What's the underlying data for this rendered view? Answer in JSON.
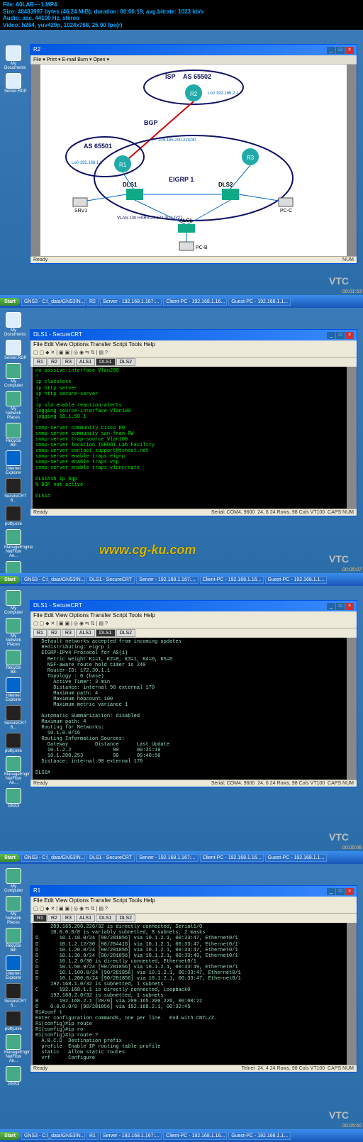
{
  "meta": {
    "file": "File: 60LAB~~1.MP4",
    "size": "Size: 48483997 bytes (46.24 MiB), duration: 00:06:19, avg.bitrate: 1023 kb/s",
    "audio": "Audio: aac, 44100 Hz, stereo",
    "video": "Video: h264, yuv420p, 1024x768, 25.00 fps(r)"
  },
  "watermark": "www.cg-ku.com",
  "vtc": "VTC",
  "desktop": {
    "icons_row1": [
      "My Documents",
      "Server.RDP"
    ],
    "icons_col": [
      "My Computer",
      "My Network Places",
      "Recycle Bin",
      "Internet Explorer",
      "SecureCRT 6...",
      "putty.exe",
      "ManageEngine NetFlow An...",
      "GNS3"
    ]
  },
  "taskbar": {
    "start": "Start",
    "items": [
      "GNS3 - C:\\_data\\GNS3\\N...",
      "R2",
      "Server - 192.168.1.167:...",
      "Client-PC - 192.168.1.16...",
      "Guest-PC - 192.168.1.1..."
    ],
    "items2": [
      "GNS3 - C:\\_data\\GNS3\\N...",
      "DLS1 - SecureCRT",
      "Server - 192.168.1.167:...",
      "Client-PC - 192.168.1.16...",
      "Guest-PC - 192.168.1.1..."
    ],
    "items3": [
      "GNS3 - C:\\_data\\GNS3\\N...",
      "R1",
      "Server - 192.168.1.167:...",
      "Client-PC - 192.168.1.16...",
      "Guest-PC - 192.168.1.1..."
    ]
  },
  "ts": [
    "00:01:53",
    "00:05:07",
    "00:05:08",
    "00:05:50"
  ],
  "panel1": {
    "window_title": "R2",
    "toolbar_items": "File ▾  Print ▾  E-mail  Burn ▾  Open ▾",
    "labels": {
      "isp": "ISP",
      "as2": "AS 65502",
      "r2": "R2",
      "r2ip": "Lo0\n192.168.2.1",
      "bgp": "BGP",
      "link": "209.165.200.224/30",
      "as1": "AS 65501",
      "r1ip": "Lo0\n192.168.1.1",
      "r1": "R1",
      "r3": "R3",
      "dls1": "DLS1",
      "dls2": "DLS2",
      "eigrp": "EIGRP 1",
      "srv1": "SRV1",
      "pcc": "PC-C",
      "als1": "ALS1",
      "pcb": "PC-B",
      "vlan": "VLAN 130 HSRVCS\n172.30.1.0/27"
    },
    "status_left": "Ready",
    "status_right": "NUM"
  },
  "panel2": {
    "window_title": "DLS1 - SecureCRT",
    "menu": "File  Edit  View  Options  Transfer  Script  Tools  Help",
    "tabs": [
      "R1",
      "R2",
      "R3",
      "ALS1",
      "DLS1",
      "DLS2"
    ],
    "active_tab": "DLS1",
    "lines": [
      "no passive-interface Vlan200",
      "!",
      "ip classless",
      "ip http server",
      "ip http secure-server",
      "!",
      "ip sla enable reaction-alerts",
      "logging source-interface Vlan100",
      "logging 10.1.50.1",
      "!",
      "snmp-server community cisco RO",
      "snmp-server community san-fran RW",
      "snmp-server trap-source Vlan100",
      "snmp-server location TSHOOT Lab Facility",
      "snmp-server contact support@tshoot.net",
      "snmp-server enable traps eigrp",
      "snmp-server enable traps vtp",
      "snmp-server enable traps vlancreate",
      "",
      "DLS1#sh ip bgp",
      "% BGP not active",
      "",
      "DLS1#"
    ],
    "status_left": "Ready",
    "status_mid": "Serial: COM4, 9600",
    "status_rows": "24, 6    24 Rows, 98 Cols  VT100",
    "status_caps": "CAPS NUM"
  },
  "panel3": {
    "window_title": "DLS1 - SecureCRT",
    "lines": [
      "  Default networks accepted from incoming updates",
      "  Redistributing: eigrp 1",
      "  EIGRP-IPv4 Protocol for AS(1)",
      "    Metric weight K1=1, K2=0, K3=1, K4=0, K5=0",
      "    NSF-aware route hold timer is 240",
      "    Router-ID: 172.30.1.1",
      "    Topology : 0 (base)",
      "      Active Timer: 3 min",
      "      Distance: internal 90 external 170",
      "      Maximum path: 4",
      "      Maximum hopcount 100",
      "      Maximum metric variance 1",
      "",
      "  Automatic Summarization: disabled",
      "  Maximum path: 4",
      "  Routing for Networks:",
      "    10.1.0.0/16",
      "  Routing Information Sources:",
      "    Gateway         Distance      Last Update",
      "    10.1.2.2              90      00:31:19",
      "    10.1.200.253          90      00:40:56",
      "  Distance: internal 90 external 170",
      "",
      "DLS1#"
    ]
  },
  "panel4": {
    "window_title": "R1",
    "active_tab": "R1",
    "lines": [
      "     209.165.200.226/32 is directly connected, Serial1/0",
      "     10.0.0.0/8 is variably subnetted, 8 subnets, 2 masks",
      "D       10.1.10.0/24 [90/281856] via 10.1.2.1, 00:33:47, Ethernet0/1",
      "D       10.1.2.12/30 [90/284416] via 10.1.2.1, 00:33:47, Ethernet0/1",
      "D       10.1.20.0/24 [90/281856] via 10.1.2.1, 00:33:47, Ethernet0/1",
      "D       10.1.30.0/24 [90/281856] via 10.1.2.1, 00:33:49, Ethernet0/1",
      "C       10.1.2.0/30 is directly connected, Ethernet0/1",
      "D       10.1.50.0/24 [90/281856] via 10.1.2.1, 00:33:49, Ethernet0/1",
      "D       10.1.100.0/24 [90/281856] via 10.1.2.1, 00:33:47, Ethernet0/1",
      "D       10.1.200.0/24 [90/281856] via 10.1.2.1, 00:33:47, Ethernet0/1",
      "     192.168.1.0/32 is subnetted, 1 subnets",
      "C       192.168.1.1 is directly connected, Loopback0",
      "     192.168.2.0/32 is subnetted, 1 subnets",
      "B       192.168.2.1 [20/0] via 209.165.200.226, 00:00:22",
      "D    0.0.0.0/0 [90/281856] via 192.168.2.1, 00:32:45",
      "R1#conf t",
      "Enter configuration commands, one per line.  End with CNTL/Z.",
      "R1(config)#ip route",
      "R1(config)#ip ro",
      "R1(config)#ip route ?",
      "  A.B.C.D  Destination prefix",
      "  profile  Enable IP routing table profile",
      "  static   Allow static routes",
      "  vrf      Configure"
    ],
    "status_mid": "Telnet",
    "status_rows": "24, 4    24 Rows, 98 Cols  VT100"
  }
}
